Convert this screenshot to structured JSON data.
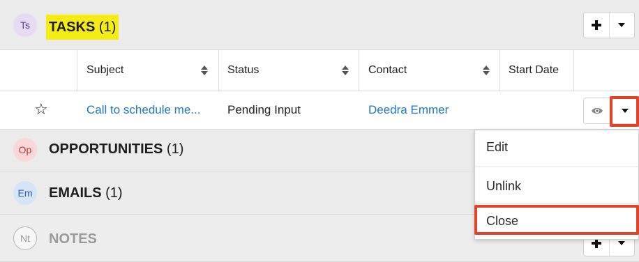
{
  "tasks": {
    "avatar": "Ts",
    "title": "TASKS",
    "count": "(1)",
    "columns": [
      {
        "label": "Subject"
      },
      {
        "label": "Status"
      },
      {
        "label": "Contact"
      },
      {
        "label": "Start Date"
      }
    ],
    "rows": [
      {
        "subject": "Call to schedule me...",
        "status": "Pending Input",
        "contact": "Deedra Emmer",
        "start_date": ""
      }
    ]
  },
  "opportunities": {
    "avatar": "Op",
    "title": "OPPORTUNITIES",
    "count": "(1)"
  },
  "emails": {
    "avatar": "Em",
    "title": "EMAILS",
    "count": "(1)"
  },
  "notes": {
    "avatar": "Nt",
    "title": "NOTES"
  },
  "row_actions_menu": {
    "items": [
      "Edit",
      "Unlink",
      "Close"
    ]
  },
  "icons": {
    "star": "star-outline-icon",
    "preview": "eye-icon",
    "add": "plus-icon",
    "more": "caret-down-icon",
    "sort": "sort-icon"
  },
  "colors": {
    "highlight_yellow": "#f5ec14",
    "annotation_red": "#e0432a",
    "link_blue": "#1f76c4"
  }
}
